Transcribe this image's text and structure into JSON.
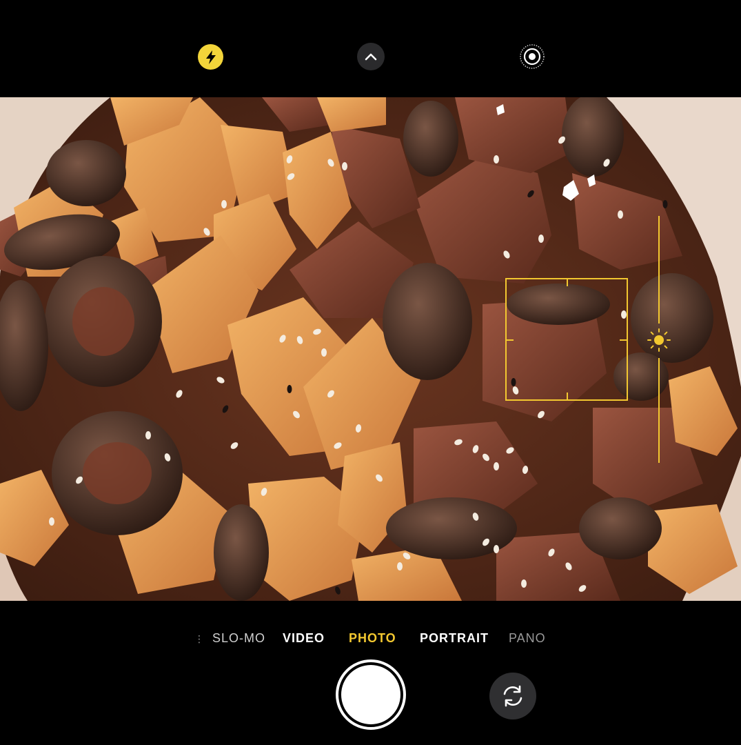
{
  "top_controls": {
    "flash_icon": "flash-icon",
    "chevron_icon": "chevron-up-icon",
    "live_icon": "live-photo-icon"
  },
  "modes": [
    {
      "label": "SLO-MO",
      "active": false
    },
    {
      "label": "VIDEO",
      "active": false
    },
    {
      "label": "PHOTO",
      "active": true
    },
    {
      "label": "PORTRAIT",
      "active": false
    },
    {
      "label": "PANO",
      "active": false
    }
  ],
  "colors": {
    "accent": "#f3c830",
    "flash": "#f3d53a",
    "background": "#000000"
  },
  "viewfinder": {
    "focus_icon": "focus-square-icon",
    "exposure_icon": "sun-icon"
  },
  "shutter_icon": "shutter-button",
  "flip_icon": "camera-flip-icon"
}
